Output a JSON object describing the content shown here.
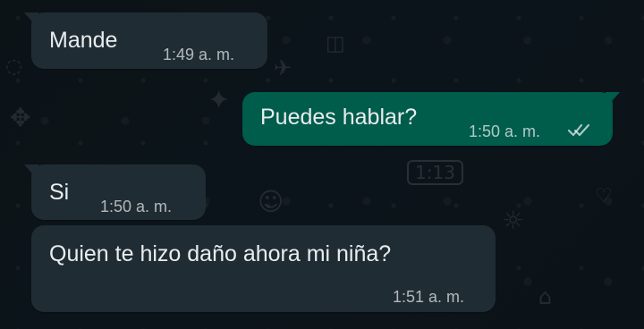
{
  "chat": {
    "messages": [
      {
        "direction": "incoming",
        "text": "Mande",
        "time": "1:49 a. m."
      },
      {
        "direction": "outgoing",
        "text": "Puedes hablar?",
        "time": "1:50 a. m.",
        "status_icon": "double-check-icon"
      },
      {
        "direction": "incoming",
        "text": "Si",
        "time": "1:50 a. m."
      },
      {
        "direction": "incoming",
        "text": "Quien te hizo daño ahora mi niña?",
        "time": "1:51 a. m."
      }
    ]
  },
  "theme": {
    "background": "#0b141a",
    "incoming_bubble": "#202c33",
    "outgoing_bubble": "#005c4b",
    "text": "#e9edef",
    "meta": "#aebac1"
  }
}
